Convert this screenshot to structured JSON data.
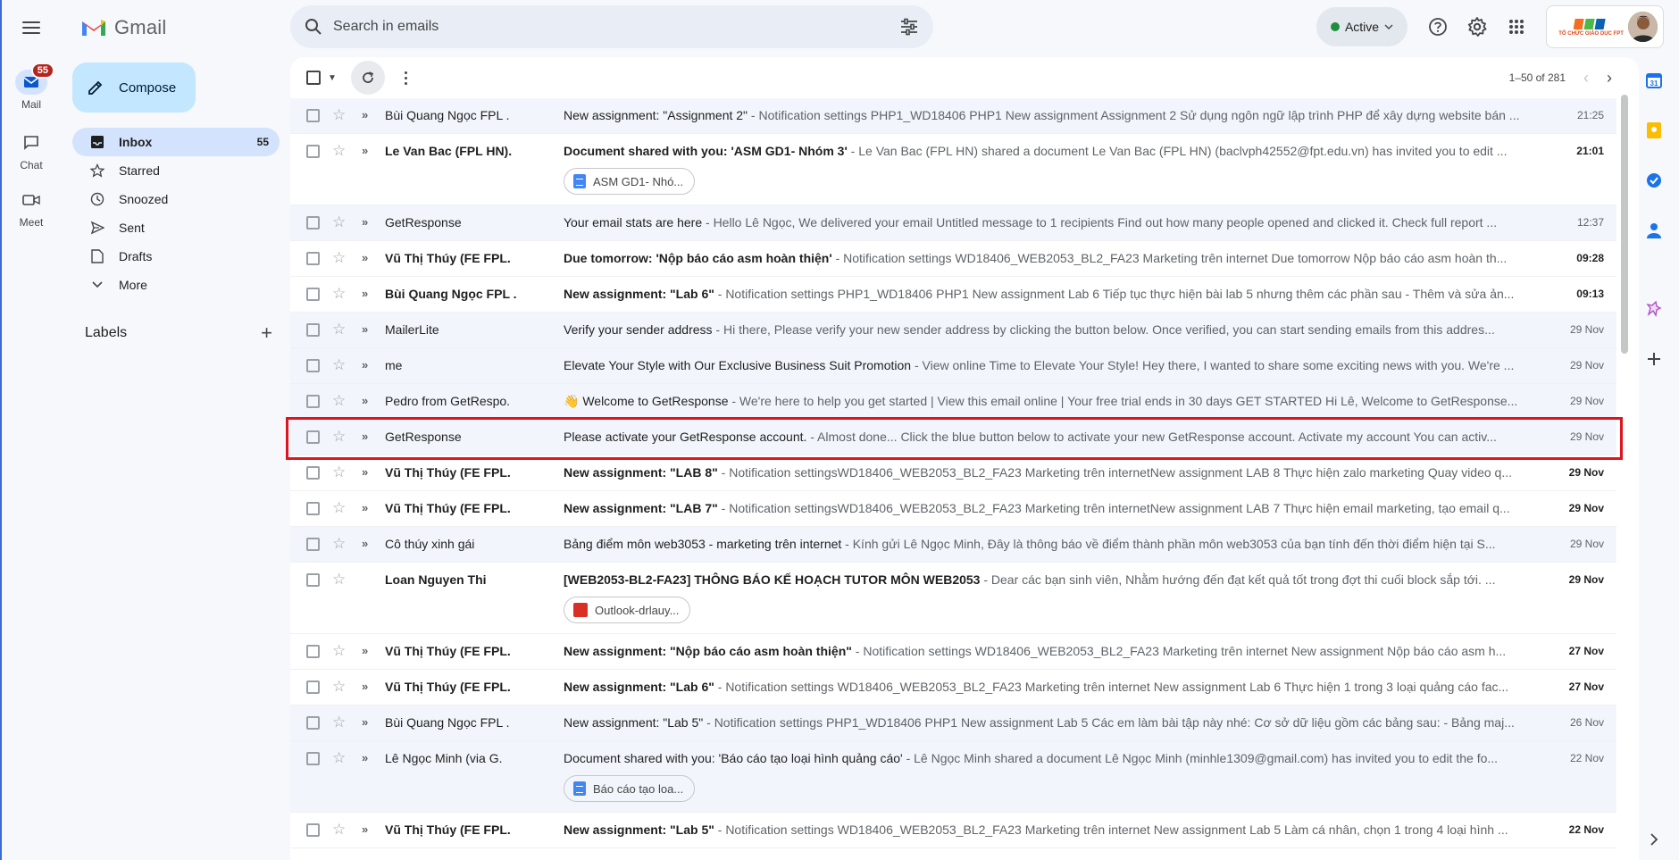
{
  "app": {
    "name": "Gmail"
  },
  "rail": {
    "items": [
      {
        "label": "Mail",
        "badge": "55"
      },
      {
        "label": "Chat"
      },
      {
        "label": "Meet"
      }
    ]
  },
  "sidebar": {
    "compose_label": "Compose",
    "items": [
      {
        "label": "Inbox",
        "count": "55"
      },
      {
        "label": "Starred"
      },
      {
        "label": "Snoozed"
      },
      {
        "label": "Sent"
      },
      {
        "label": "Drafts"
      },
      {
        "label": "More"
      }
    ],
    "labels_title": "Labels"
  },
  "search": {
    "placeholder": "Search in emails"
  },
  "status": {
    "label": "Active"
  },
  "account": {
    "org_name": "TỔ CHỨC GIÁO DỤC FPT"
  },
  "toolbar": {
    "pagination": "1–50 of 281"
  },
  "emails": [
    {
      "sender": "Bùi Quang Ngọc FPL .",
      "subject": "New assignment: \"Assignment 2\"",
      "snippet": " - Notification settings PHP1_WD18406 PHP1 New assignment Assignment 2 Sử dụng ngôn ngữ lập trình PHP để xây dựng website bán ...",
      "date": "21:25",
      "unread": false,
      "important": true
    },
    {
      "sender": "Le Van Bac (FPL HN).",
      "subject": "Document shared with you: 'ASM GD1- Nhóm 3'",
      "snippet": " - Le Van Bac (FPL HN) shared a document Le Van Bac (FPL HN) (baclvph42552@fpt.edu.vn) has invited you to edit ...",
      "date": "21:01",
      "unread": true,
      "important": true,
      "attachment": "ASM GD1- Nhó...",
      "attachment_type": "doc"
    },
    {
      "sender": "GetResponse",
      "subject": "Your email stats are here",
      "snippet": " - Hello Lê Ngọc, We delivered your email Untitled message to 1 recipients Find out how many people opened and clicked it. Check full report ...",
      "date": "12:37",
      "unread": false,
      "important": true
    },
    {
      "sender": "Vũ Thị Thúy (FE FPL.",
      "subject": "Due tomorrow: 'Nộp báo cáo asm hoàn thiện'",
      "snippet": " - Notification settings WD18406_WEB2053_BL2_FA23 Marketing trên internet Due tomorrow Nộp báo cáo asm hoàn th...",
      "date": "09:28",
      "unread": true,
      "important": true
    },
    {
      "sender": "Bùi Quang Ngọc FPL .",
      "subject": "New assignment: \"Lab 6\"",
      "snippet": " - Notification settings PHP1_WD18406 PHP1 New assignment Lab 6 Tiếp tục thực hiện bài lab 5 nhưng thêm các phần sau - Thêm và sửa ản...",
      "date": "09:13",
      "unread": true,
      "important": true
    },
    {
      "sender": "MailerLite",
      "subject": "Verify your sender address",
      "snippet": " - Hi there, Please verify your new sender address by clicking the button below. Once verified, you can start sending emails from this addres...",
      "date": "29 Nov",
      "unread": false,
      "important": true
    },
    {
      "sender": "me",
      "subject": "Elevate Your Style with Our Exclusive Business Suit Promotion",
      "snippet": " - View online Time to Elevate Your Style! Hey there, I wanted to share some exciting news with you. We're ...",
      "date": "29 Nov",
      "unread": false,
      "important": true
    },
    {
      "sender": "Pedro from GetRespo.",
      "subject": "👋 Welcome to GetResponse",
      "snippet": " - We're here to help you get started | View this email online | Your free trial ends in 30 days GET STARTED Hi Lê, Welcome to GetResponse...",
      "date": "29 Nov",
      "unread": false,
      "important": true
    },
    {
      "sender": "GetResponse",
      "subject": "Please activate your GetResponse account.",
      "snippet": " - Almost done... Click the blue button below to activate your new GetResponse account. Activate my account You can activ...",
      "date": "29 Nov",
      "unread": false,
      "important": true
    },
    {
      "sender": "Vũ Thị Thúy (FE FPL.",
      "subject": "New assignment: \"LAB 8\"",
      "snippet": " - Notification settingsWD18406_WEB2053_BL2_FA23 Marketing trên internetNew assignment LAB 8 Thực hiện zalo marketing Quay video q...",
      "date": "29 Nov",
      "unread": true,
      "important": true
    },
    {
      "sender": "Vũ Thị Thúy (FE FPL.",
      "subject": "New assignment: \"LAB 7\"",
      "snippet": " - Notification settingsWD18406_WEB2053_BL2_FA23 Marketing trên internetNew assignment LAB 7 Thực hiện email marketing, tạo email q...",
      "date": "29 Nov",
      "unread": true,
      "important": true
    },
    {
      "sender": "Cô thúy xinh gái",
      "subject": "Bảng điểm môn web3053 - marketing trên internet",
      "snippet": " - Kính gửi Lê Ngọc Minh, Đây là thông báo về điểm thành phần môn web3053 của bạn tính đến thời điểm hiện tại S...",
      "date": "29 Nov",
      "unread": false,
      "important": true
    },
    {
      "sender": "Loan Nguyen Thi",
      "subject": "[WEB2053-BL2-FA23] THÔNG BÁO KẾ HOẠCH TUTOR MÔN WEB2053",
      "snippet": " - Dear các bạn sinh viên, Nhằm hướng đến đạt kết quả tốt trong đợt thi cuối block sắp tới. ...",
      "date": "29 Nov",
      "unread": true,
      "important": false,
      "attachment": "Outlook-drlauy...",
      "attachment_type": "image"
    },
    {
      "sender": "Vũ Thị Thúy (FE FPL.",
      "subject": "New assignment: \"Nộp báo cáo asm hoàn thiện\"",
      "snippet": " - Notification settings WD18406_WEB2053_BL2_FA23 Marketing trên internet New assignment Nộp báo cáo asm h...",
      "date": "27 Nov",
      "unread": true,
      "important": true
    },
    {
      "sender": "Vũ Thị Thúy (FE FPL.",
      "subject": "New assignment: \"Lab 6\"",
      "snippet": " - Notification settings WD18406_WEB2053_BL2_FA23 Marketing trên internet New assignment Lab 6 Thực hiện 1 trong 3 loại quảng cáo fac...",
      "date": "27 Nov",
      "unread": true,
      "important": true
    },
    {
      "sender": "Bùi Quang Ngọc FPL .",
      "subject": "New assignment: \"Lab 5\"",
      "snippet": " - Notification settings PHP1_WD18406 PHP1 New assignment Lab 5 Các em làm bài tập này nhé: Cơ sở dữ liệu gồm các bảng sau: - Bảng maj...",
      "date": "26 Nov",
      "unread": false,
      "important": true
    },
    {
      "sender": "Lê Ngọc Minh (via G.",
      "subject": "Document shared with you: 'Báo cáo tạo loại hình quảng cáo'",
      "snippet": " - Lê Ngọc Minh shared a document Lê Ngọc Minh (minhle1309@gmail.com) has invited you to edit the fo...",
      "date": "22 Nov",
      "unread": false,
      "important": true,
      "attachment": "Báo cáo tạo loa...",
      "attachment_type": "doc"
    },
    {
      "sender": "Vũ Thị Thúy (FE FPL.",
      "subject": "New assignment: \"Lab 5\"",
      "snippet": " - Notification settings WD18406_WEB2053_BL2_FA23 Marketing trên internet New assignment Lab 5 Làm cá nhân, chọn 1 trong 4 loại hình ...",
      "date": "22 Nov",
      "unread": true,
      "important": true
    }
  ],
  "colors": {
    "accent": "#0b57d0",
    "compose_bg": "#c2e7ff",
    "active_nav": "#d3e3fd",
    "highlight_box": "#e0141e",
    "badge": "#b3261e"
  }
}
